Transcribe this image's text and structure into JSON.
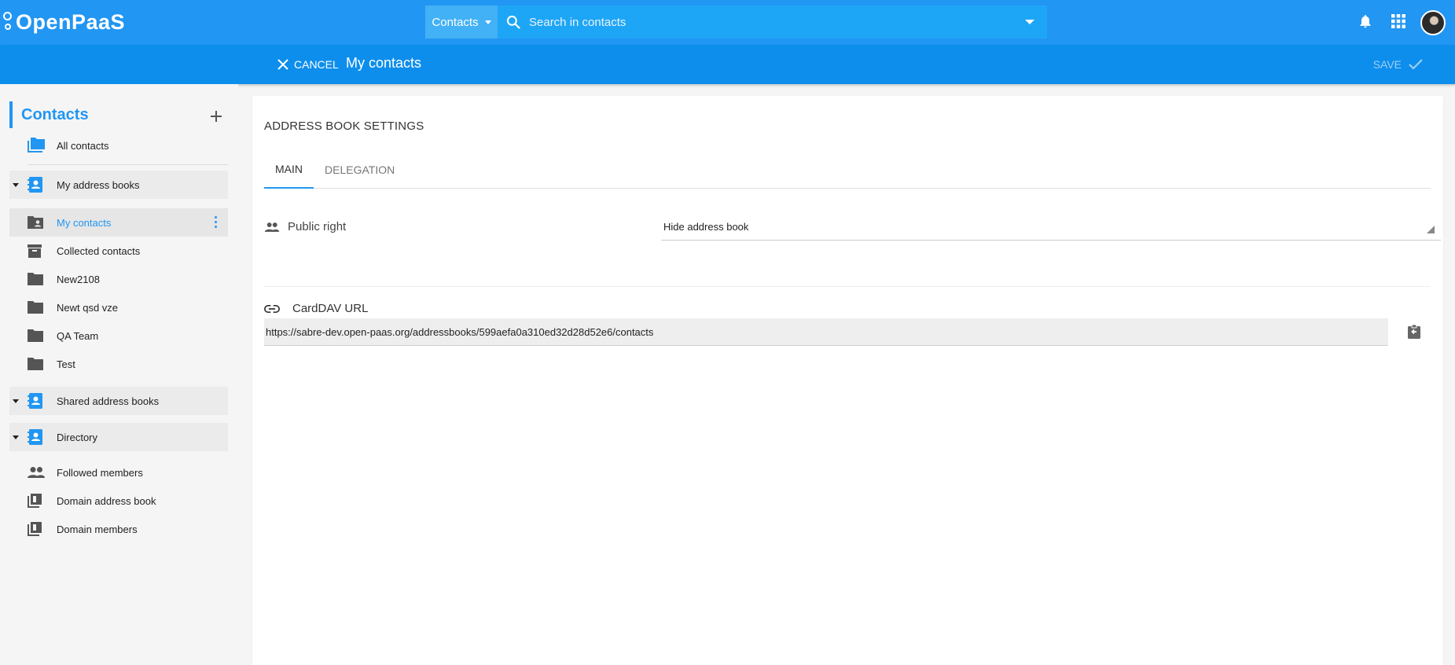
{
  "header": {
    "logo_text": "OpenPaaS",
    "search_scope": "Contacts",
    "search_placeholder": "Search in contacts"
  },
  "subheader": {
    "cancel_label": "CANCEL",
    "title": "My contacts",
    "save_label": "SAVE"
  },
  "sidebar": {
    "title": "Contacts",
    "all_contacts": "All contacts",
    "groups": {
      "my_address_books": "My address books",
      "shared_address_books": "Shared address books",
      "directory": "Directory"
    },
    "my_books": [
      "My contacts",
      "Collected contacts",
      "New2108",
      "Newt qsd vze",
      "QA Team",
      "Test"
    ],
    "directory_items": [
      "Followed members",
      "Domain address book",
      "Domain members"
    ]
  },
  "main": {
    "title": "ADDRESS BOOK SETTINGS",
    "tabs": [
      "MAIN",
      "DELEGATION"
    ],
    "public_right_label": "Public right",
    "public_right_value": "Hide address book",
    "carddav_label": "CardDAV URL",
    "carddav_url": "https://sabre-dev.open-paas.org/addressbooks/599aefa0a310ed32d28d52e6/contacts"
  },
  "colors": {
    "primary": "#2196f3",
    "subheader": "#0d8eec"
  }
}
